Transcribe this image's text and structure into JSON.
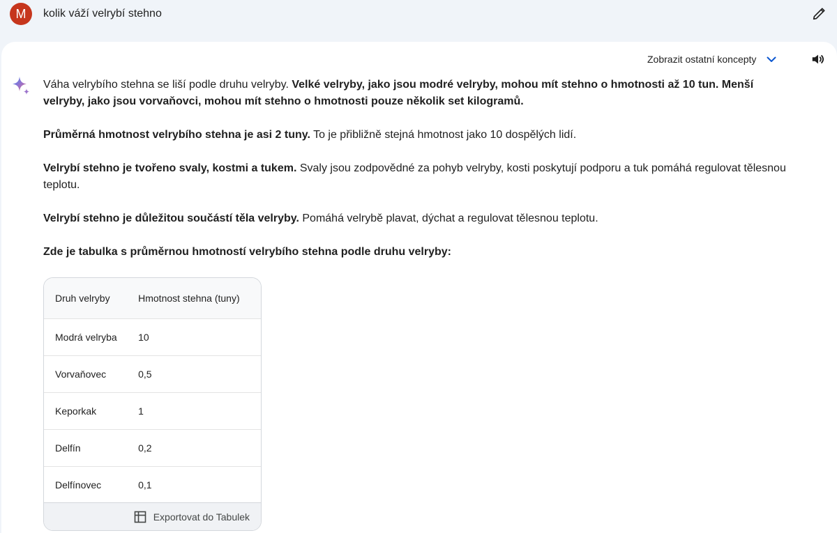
{
  "user": {
    "avatar_letter": "M",
    "avatar_color": "#c6361d",
    "prompt": "kolik váží velrybí stehno"
  },
  "icons": {
    "edit": "pencil-icon",
    "drafts_chevron": "chevron-down-icon",
    "speaker": "speaker-icon",
    "assistant": "sparkle-icon",
    "export": "sheets-table-icon"
  },
  "toolbar": {
    "show_drafts_label": "Zobrazit ostatní koncepty"
  },
  "response": {
    "p1": {
      "normal": "Váha velrybího stehna se liší podle druhu velryby. ",
      "bold": "Velké velryby, jako jsou modré velryby, mohou mít stehno o hmotnosti až 10 tun. Menší velryby, jako jsou vorvaňovci, mohou mít stehno o hmotnosti pouze několik set kilogramů."
    },
    "p2": {
      "bold": "Průměrná hmotnost velrybího stehna je asi 2 tuny.",
      "normal": " To je přibližně stejná hmotnost jako 10 dospělých lidí."
    },
    "p3": {
      "bold": "Velrybí stehno je tvořeno svaly, kostmi a tukem.",
      "normal": " Svaly jsou zodpovědné za pohyb velryby, kosti poskytují podporu a tuk pomáhá regulovat tělesnou teplotu."
    },
    "p4": {
      "bold": "Velrybí stehno je důležitou součástí těla velryby.",
      "normal": " Pomáhá velrybě plavat, dýchat a regulovat tělesnou teplotu."
    },
    "table_intro": "Zde je tabulka s průměrnou hmotností velrybího stehna podle druhu velryby:"
  },
  "table": {
    "headers": [
      "Druh velryby",
      "Hmotnost stehna (tuny)"
    ],
    "rows": [
      [
        "Modrá velryba",
        "10"
      ],
      [
        "Vorvaňovec",
        "0,5"
      ],
      [
        "Keporkak",
        "1"
      ],
      [
        "Delfín",
        "0,2"
      ],
      [
        "Delfínovec",
        "0,1"
      ]
    ],
    "export_label": "Exportovat do Tabulek"
  },
  "colors": {
    "background": "#f0f4f9",
    "card": "#ffffff",
    "accent_blue": "#0b57d0",
    "sparkle_blue": "#4285f4",
    "sparkle_purple": "#9b72cb",
    "sparkle_red": "#d96570"
  }
}
